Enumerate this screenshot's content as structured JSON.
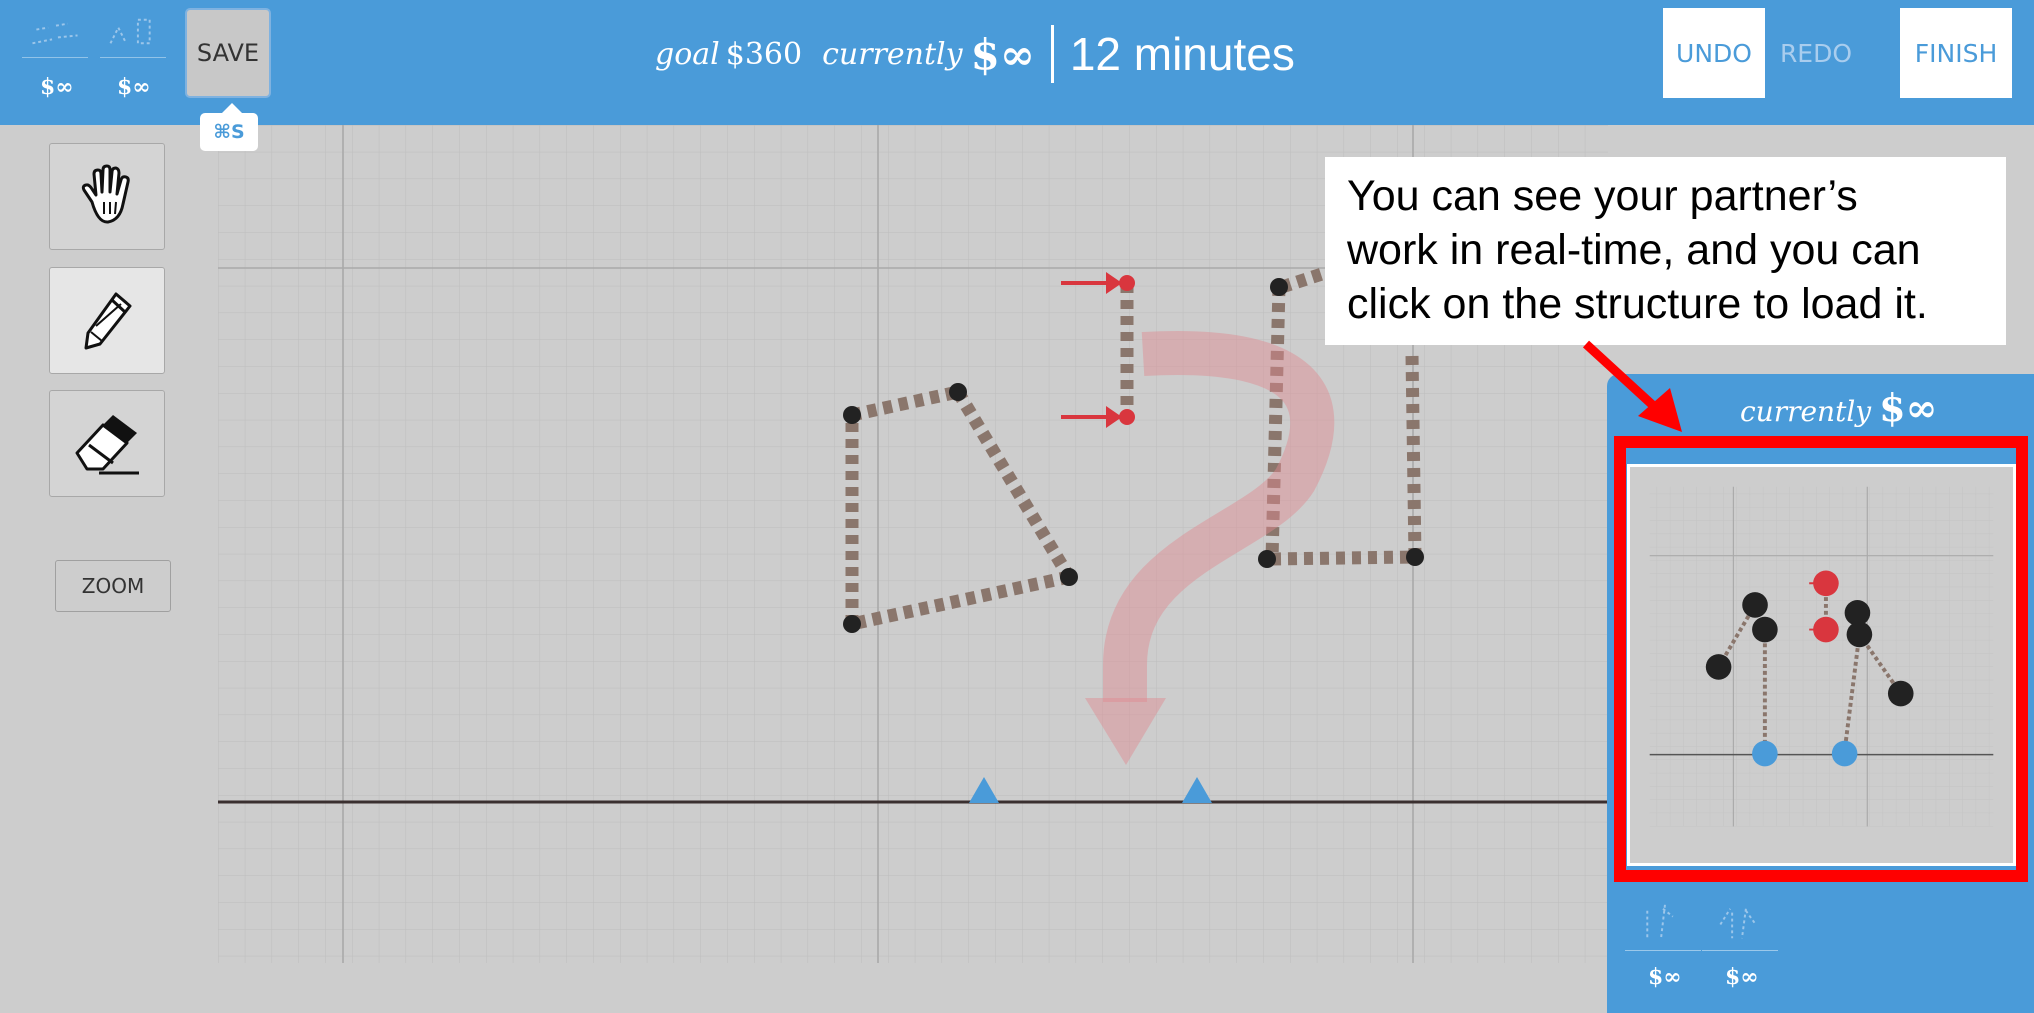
{
  "header": {
    "saved_designs": [
      {
        "cost": "$∞"
      },
      {
        "cost": "$∞"
      }
    ],
    "save_label": "SAVE",
    "save_shortcut": "⌘S",
    "goal_label": "goal",
    "goal_value": "$360",
    "current_label": "currently",
    "current_value": "$∞",
    "time_remaining": "12 minutes",
    "undo_label": "UNDO",
    "redo_label": "REDO",
    "finish_label": "FINISH"
  },
  "toolbar": {
    "tools": [
      {
        "name": "hand",
        "icon": "hand-icon",
        "active": false
      },
      {
        "name": "pencil",
        "icon": "pencil-icon",
        "active": true
      },
      {
        "name": "eraser",
        "icon": "eraser-icon",
        "active": false
      }
    ],
    "zoom_label": "ZOOM"
  },
  "callout": {
    "lines": [
      "You can see your partner’s",
      "work in real-time, and you can",
      "click on the structure to load it."
    ]
  },
  "partner_panel": {
    "current_label": "currently",
    "current_value": "$∞",
    "saved_designs": [
      {
        "cost": "$∞"
      },
      {
        "cost": "$∞"
      }
    ]
  },
  "colors": {
    "accent_blue": "#4a9bd9",
    "beam_brown": "#8a766c",
    "node_dark": "#222222",
    "load_red": "#d9363e",
    "highlight_red": "#ff0000",
    "grid_bg": "#cdcdcd"
  }
}
